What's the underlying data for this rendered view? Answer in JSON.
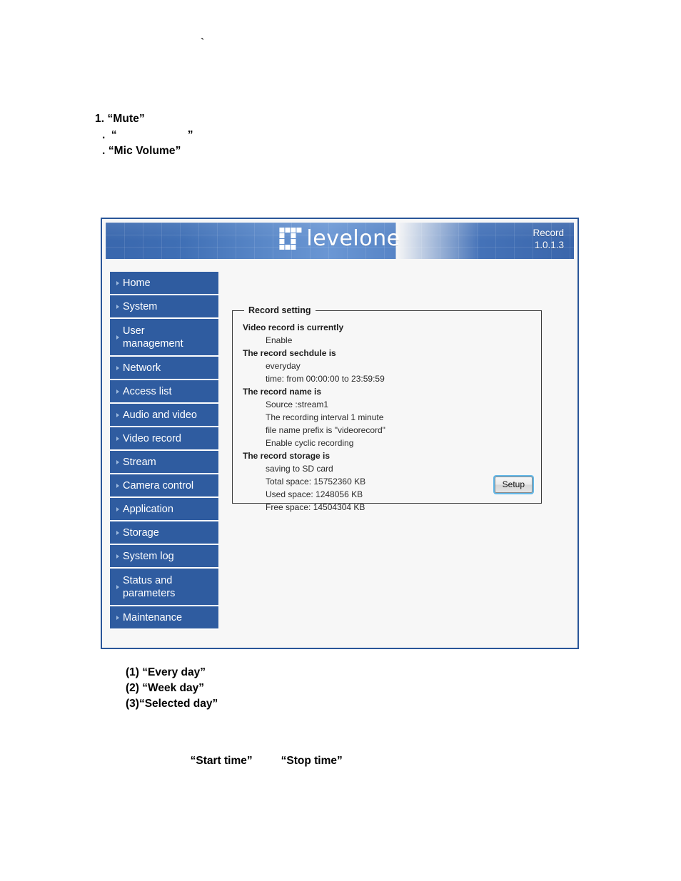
{
  "document": {
    "stray_mark": "`",
    "top_notes": [
      "1. “Mute”",
      ".  “                       ”",
      ". “Mic Volume”"
    ],
    "schedule_notes": [
      "(1) “Every day”",
      "(2) “Week day”",
      "(3)“Selected day”"
    ],
    "time_note_start": "“Start time”",
    "time_note_stop": "“Stop time”"
  },
  "screenshot": {
    "header": {
      "brand": "levelone",
      "page_title": "Record",
      "version": "1.0.1.3",
      "brand_mark_icon": "levelone-grid-logo-icon",
      "colors": {
        "bar_blue": "#3f6fb5",
        "bar_highlight": "#6b97d4",
        "frame_border": "#2a5699"
      }
    },
    "sidebar": {
      "items": [
        {
          "label": "Home"
        },
        {
          "label": "System"
        },
        {
          "label": "User\nmanagement"
        },
        {
          "label": "Network"
        },
        {
          "label": "Access list"
        },
        {
          "label": "Audio and video"
        },
        {
          "label": "Video record"
        },
        {
          "label": "Stream"
        },
        {
          "label": "Camera control"
        },
        {
          "label": "Application"
        },
        {
          "label": "Storage"
        },
        {
          "label": "System log"
        },
        {
          "label": "Status and\nparameters"
        },
        {
          "label": "Maintenance"
        }
      ],
      "item_color": "#2f5ca0",
      "bullet_icon": "chevron-right-icon"
    },
    "panel": {
      "legend": "Record setting",
      "groups": [
        {
          "heading": "Video record is currently",
          "values": [
            "Enable"
          ]
        },
        {
          "heading": "The record sechdule is",
          "values": [
            "everyday",
            "time: from 00:00:00 to 23:59:59"
          ]
        },
        {
          "heading": "The record name is",
          "values": [
            "Source :stream1",
            "The recording interval 1 minute",
            "file name prefix is \"videorecord\"",
            "Enable cyclic recording"
          ]
        },
        {
          "heading": "The record storage is",
          "values": [
            "saving to SD card",
            "Total space: 15752360 KB",
            "Used space: 1248056 KB",
            "Free space: 14504304 KB"
          ]
        }
      ],
      "setup_button": "Setup"
    }
  }
}
